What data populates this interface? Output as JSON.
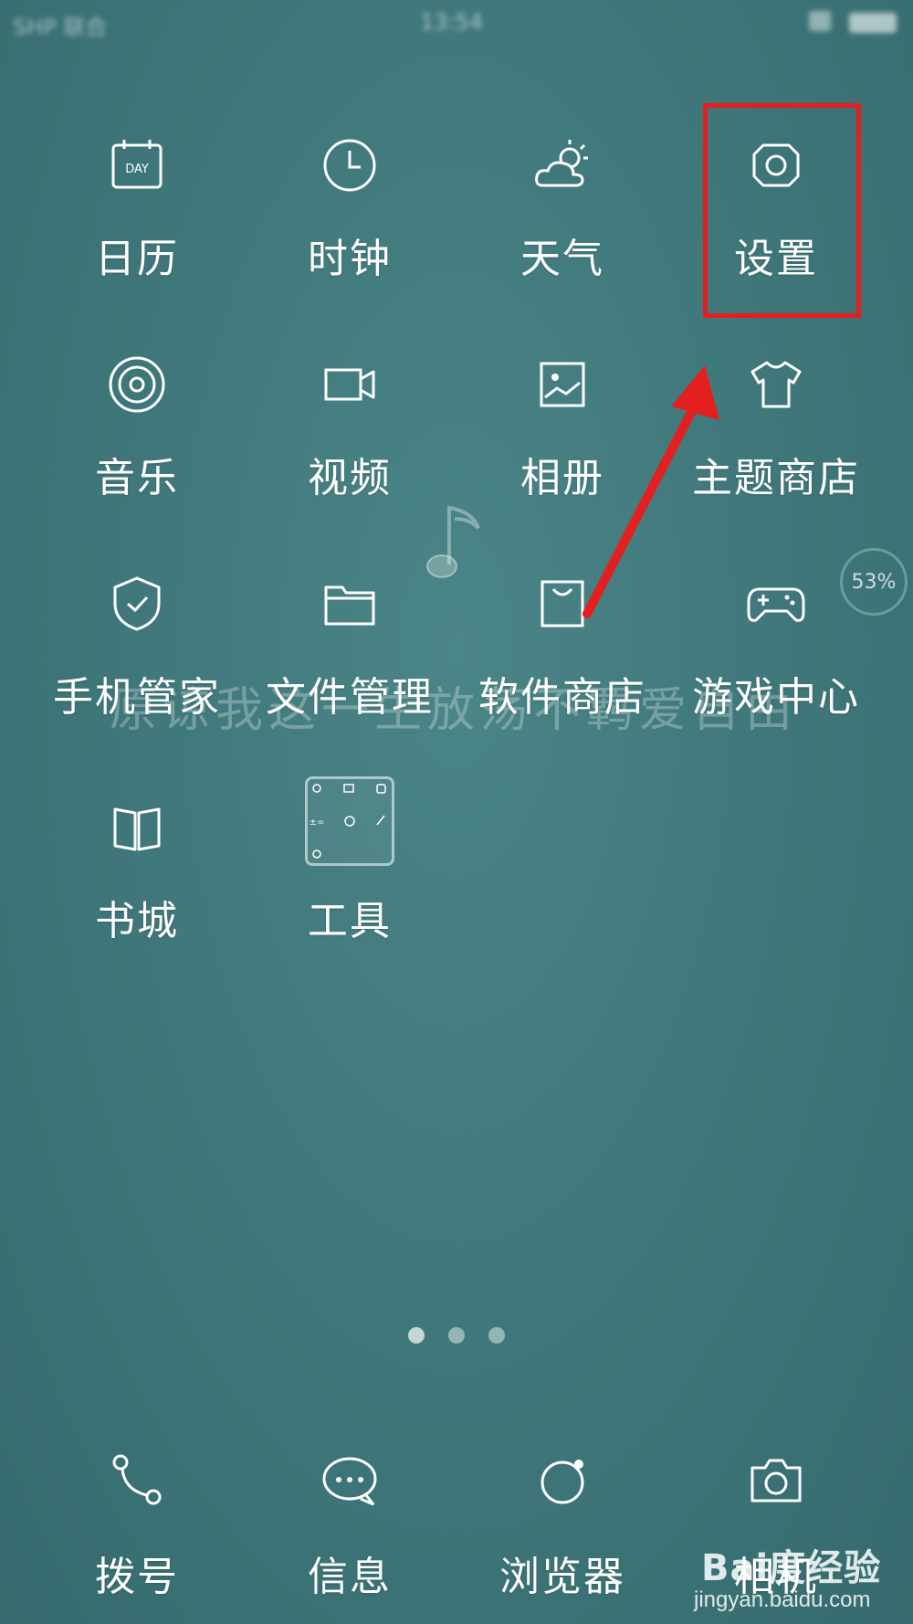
{
  "status_bar": {
    "carrier": "SHP 联合",
    "time": "13:54"
  },
  "apps": [
    {
      "id": "calendar",
      "label": "日历",
      "icon": "calendar-icon",
      "icon_text": "DAY"
    },
    {
      "id": "clock",
      "label": "时钟",
      "icon": "clock-icon"
    },
    {
      "id": "weather",
      "label": "天气",
      "icon": "weather-icon"
    },
    {
      "id": "settings",
      "label": "设置",
      "icon": "gear-icon"
    },
    {
      "id": "music",
      "label": "音乐",
      "icon": "disc-icon"
    },
    {
      "id": "video",
      "label": "视频",
      "icon": "video-camera-icon"
    },
    {
      "id": "gallery",
      "label": "相册",
      "icon": "picture-icon"
    },
    {
      "id": "theme_store",
      "label": "主题商店",
      "icon": "tshirt-icon"
    },
    {
      "id": "phone_manager",
      "label": "手机管家",
      "icon": "shield-icon"
    },
    {
      "id": "file_manager",
      "label": "文件管理",
      "icon": "folder-icon"
    },
    {
      "id": "app_store",
      "label": "软件商店",
      "icon": "shopping-bag-icon"
    },
    {
      "id": "game_center",
      "label": "游戏中心",
      "icon": "gamepad-icon"
    },
    {
      "id": "bookstore",
      "label": "书城",
      "icon": "book-icon"
    },
    {
      "id": "tools",
      "label": "工具",
      "icon": "tools-folder-icon"
    }
  ],
  "wallpaper_text": "原谅我这一生放荡不羁爱自由",
  "widget": {
    "percent_label": "53%",
    "value": 53
  },
  "page_indicator": {
    "count": 3,
    "active": 0
  },
  "dock": [
    {
      "id": "dialer",
      "label": "拨号",
      "icon": "phone-icon"
    },
    {
      "id": "messages",
      "label": "信息",
      "icon": "message-bubble-icon"
    },
    {
      "id": "browser",
      "label": "浏览器",
      "icon": "globe-icon"
    },
    {
      "id": "camera",
      "label": "相机",
      "icon": "camera-icon"
    }
  ],
  "annotation": {
    "color": "#e41f1f",
    "target": "settings"
  },
  "watermark": {
    "brand": "Bai度经验",
    "site": "jingyan.baidu.com"
  }
}
